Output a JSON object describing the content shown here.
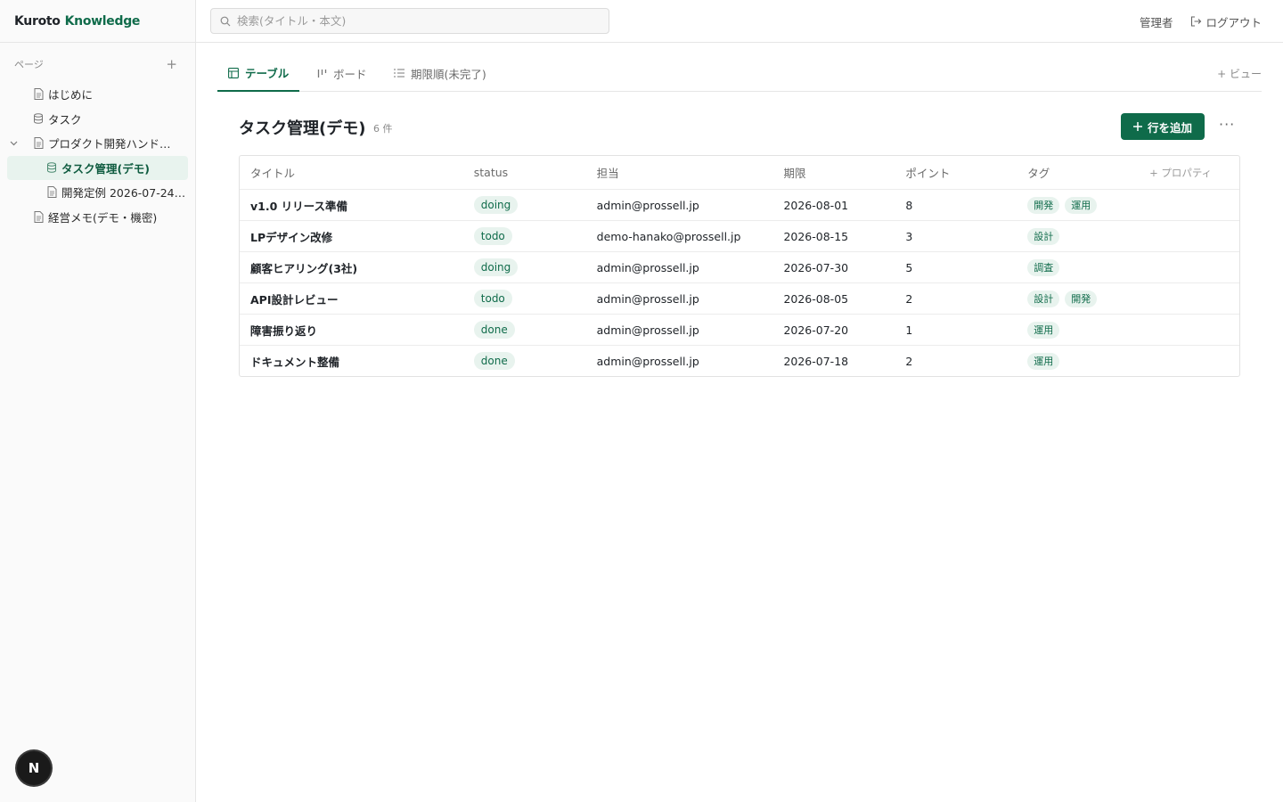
{
  "app": {
    "brand_left": "Kuroto",
    "brand_right": "Knowledge"
  },
  "search": {
    "placeholder": "検索(タイトル・本文)"
  },
  "topbar": {
    "user": "管理者",
    "logout": "ログアウト"
  },
  "sidebar": {
    "section_label": "ページ",
    "items": [
      {
        "label": "はじめに"
      },
      {
        "label": "タスク"
      },
      {
        "label": "プロダクト開発ハンド…"
      },
      {
        "label": "タスク管理(デモ)"
      },
      {
        "label": "開発定例 2026-07-24…"
      },
      {
        "label": "経営メモ(デモ・機密)"
      }
    ],
    "fab": "N"
  },
  "tabs": [
    {
      "label": "テーブル"
    },
    {
      "label": "ボード"
    },
    {
      "label": "期限順(未完了)"
    }
  ],
  "add_view": "+ ビュー",
  "db": {
    "title": "タスク管理(デモ)",
    "count": "6 件",
    "add_row": "行を追加",
    "more": "···"
  },
  "table": {
    "headers": {
      "title": "タイトル",
      "status": "status",
      "owner": "担当",
      "due": "期限",
      "points": "ポイント",
      "tags": "タグ",
      "add_prop": "+ プロパティ"
    },
    "rows": [
      {
        "title": "v1.0 リリース準備",
        "status": "doing",
        "owner": "admin@prossell.jp",
        "due": "2026-08-01",
        "points": "8",
        "tags": [
          "開発",
          "運用"
        ]
      },
      {
        "title": "LPデザイン改修",
        "status": "todo",
        "owner": "demo-hanako@prossell.jp",
        "due": "2026-08-15",
        "points": "3",
        "tags": [
          "設計"
        ]
      },
      {
        "title": "顧客ヒアリング(3社)",
        "status": "doing",
        "owner": "admin@prossell.jp",
        "due": "2026-07-30",
        "points": "5",
        "tags": [
          "調査"
        ]
      },
      {
        "title": "API設計レビュー",
        "status": "todo",
        "owner": "admin@prossell.jp",
        "due": "2026-08-05",
        "points": "2",
        "tags": [
          "設計",
          "開発"
        ]
      },
      {
        "title": "障害振り返り",
        "status": "done",
        "owner": "admin@prossell.jp",
        "due": "2026-07-20",
        "points": "1",
        "tags": [
          "運用"
        ]
      },
      {
        "title": "ドキュメント整備",
        "status": "done",
        "owner": "admin@prossell.jp",
        "due": "2026-07-18",
        "points": "2",
        "tags": [
          "運用"
        ]
      }
    ]
  }
}
